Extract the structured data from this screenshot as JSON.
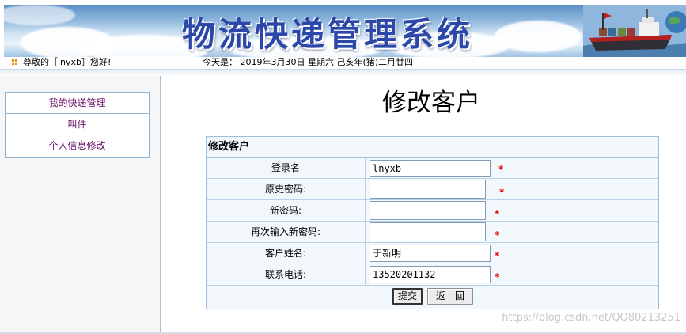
{
  "banner": {
    "title": "物流快递管理系统"
  },
  "infobar": {
    "greeting": "尊敬的［lnyxb］您好!",
    "date": "今天是： 2019年3月30日 星期六 己亥年(猪)二月廿四"
  },
  "sidebar": {
    "items": [
      {
        "label": "我的快递管理"
      },
      {
        "label": "叫件"
      },
      {
        "label": "个人信息修改"
      }
    ]
  },
  "page": {
    "title": "修改客户"
  },
  "form": {
    "header": "修改客户",
    "fields": [
      {
        "label": "登录名",
        "value": "lnyxb",
        "required_mark": "*"
      },
      {
        "label": "原史密码:",
        "value": "",
        "required_mark": "*"
      },
      {
        "label": "新密码:",
        "value": "",
        "required_mark": "*"
      },
      {
        "label": "再次输入新密码:",
        "value": "",
        "required_mark": "*"
      },
      {
        "label": "客户姓名:",
        "value": "于新明",
        "required_mark": "*"
      },
      {
        "label": "联系电话:",
        "value": "13520201132",
        "required_mark": "*"
      }
    ],
    "submit_label": "提交",
    "back_label": "返　回"
  },
  "watermark": "https://blog.csdn.net/QQ80213251",
  "colors": {
    "title_blue": "#2b48a8",
    "menu_text": "#6b0f6b",
    "required_red": "#e00000",
    "table_border": "#9ebedb",
    "table_bg": "#f2f7fc"
  }
}
